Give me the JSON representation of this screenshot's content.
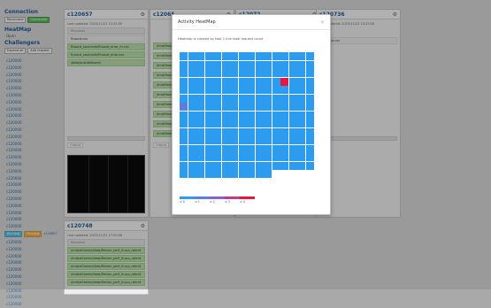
{
  "sidebar": {
    "connection": {
      "title": "Connection",
      "btn_left": "Reconnect",
      "btn_right": "Connected"
    },
    "heatmap": {
      "title": "HeatMap",
      "sub": "Open"
    },
    "challengers": {
      "title": "Challengers",
      "btn_left": "Expand all",
      "btn_right": "Add request"
    },
    "items": [
      "c120000",
      "c120000",
      "c120000",
      "c120000",
      "c120000",
      "c120000",
      "c120000",
      "c120000",
      "c120000",
      "c120000",
      "c120000",
      "c120000",
      "c120000",
      "c120000",
      "c120000",
      "c120000",
      "c120000",
      "c120000",
      "c120000",
      "c120000",
      "c120000",
      "c120000",
      "c120000",
      "c120000",
      "c120000",
      "c120000",
      "c120000",
      "c120000",
      "c120000",
      "c120000",
      "c120000",
      "c120000",
      "c120000",
      "c120000",
      "c120000"
    ],
    "tag_row": {
      "blue": "Running",
      "orange": "Pending",
      "link": "c120657"
    }
  },
  "panels": {
    "p1": {
      "title": "c120657",
      "updated": "Last updated: 2023/11/22 13:25:50",
      "label": "Requests",
      "files": [
        "fluxout.csv",
        "fluxout_sourcedir/fluxout_error_m.csv",
        "fluxout_sourcedir/fluxout_error.csv",
        "/data/outsideboxm/"
      ],
      "output": "Output"
    },
    "p2": {
      "title": "c12065",
      "output": "Output"
    },
    "p3": {
      "title": "c12072"
    },
    "p4": {
      "title": "c120736",
      "updated": "Last updated: 2023/11/22 13:25:50",
      "file": "fluxout.csv"
    },
    "p5": {
      "title": "c120748",
      "updated": "Last updated: 2023/11/22 17:50:06",
      "label": "Requests",
      "files": [
        "/mnt/aiCenter/data/Merlon_perf_it.cpu_rahmt",
        "/mnt/aiCenter/data/Merlon_perf_it.cpu_rahmt",
        "/mnt/aiCenter/data/Merlon_perf_it.cpu_rahmt",
        "/mnt/aiCenter/data/Merlon_perf_it.cpu_rahmt",
        "/mnt/aiCenter/data/Merlon_perf_it.cpu_rahmt"
      ]
    },
    "p2_rows": [
      "/mnt/fbnew",
      "/mnt/fbnew",
      "/mnt/fbnew",
      "/mnt/fbnew",
      "/mnt/fbnew",
      "/mnt/fbnew",
      "/mnt/fbnew",
      "/mnt/fbnew",
      "/mnt/fbnew",
      "/mnt/fbnew"
    ]
  },
  "modal": {
    "title": "Activity HeatMap",
    "close": "×",
    "description": "Heatmap is created by task 1 min total request count",
    "heatmap": {
      "columns": 16,
      "rows": 16,
      "full_rows": 14,
      "last_row_cells": 11,
      "base_color": "#2b9cf0",
      "highlights": [
        {
          "row": 3,
          "col": 12,
          "color": "#e8173f"
        },
        {
          "row": 6,
          "col": 0,
          "color": "#5b7fe0"
        }
      ]
    },
    "legend": {
      "colors": [
        "#2b9cf0",
        "#5b7fe0",
        "#8d5fc8",
        "#bb3d8f",
        "#e8173f"
      ],
      "labels": [
        "≥ 0",
        "≥ 1",
        "≥ 2",
        "≥ 3",
        "≥ 4"
      ]
    }
  },
  "colors": {
    "accent": "#1f5c99",
    "green": "#5cb85c",
    "heat_low": "#2b9cf0",
    "heat_high": "#e8173f"
  }
}
